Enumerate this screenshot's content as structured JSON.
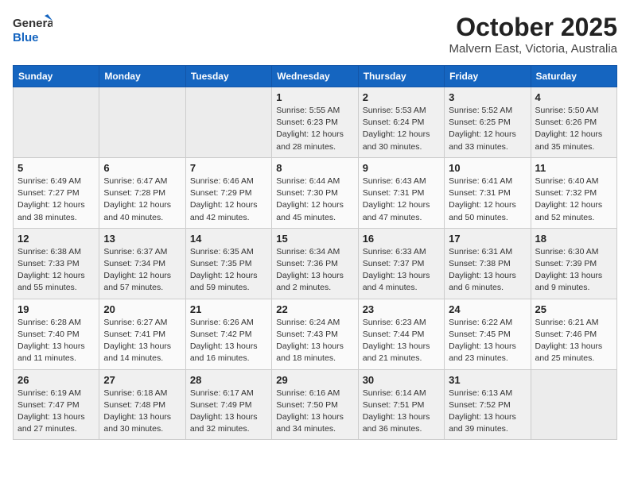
{
  "header": {
    "logo_general": "General",
    "logo_blue": "Blue",
    "month": "October 2025",
    "location": "Malvern East, Victoria, Australia"
  },
  "days_of_week": [
    "Sunday",
    "Monday",
    "Tuesday",
    "Wednesday",
    "Thursday",
    "Friday",
    "Saturday"
  ],
  "weeks": [
    [
      {
        "day": "",
        "info": ""
      },
      {
        "day": "",
        "info": ""
      },
      {
        "day": "",
        "info": ""
      },
      {
        "day": "1",
        "info": "Sunrise: 5:55 AM\nSunset: 6:23 PM\nDaylight: 12 hours and 28 minutes."
      },
      {
        "day": "2",
        "info": "Sunrise: 5:53 AM\nSunset: 6:24 PM\nDaylight: 12 hours and 30 minutes."
      },
      {
        "day": "3",
        "info": "Sunrise: 5:52 AM\nSunset: 6:25 PM\nDaylight: 12 hours and 33 minutes."
      },
      {
        "day": "4",
        "info": "Sunrise: 5:50 AM\nSunset: 6:26 PM\nDaylight: 12 hours and 35 minutes."
      }
    ],
    [
      {
        "day": "5",
        "info": "Sunrise: 6:49 AM\nSunset: 7:27 PM\nDaylight: 12 hours and 38 minutes."
      },
      {
        "day": "6",
        "info": "Sunrise: 6:47 AM\nSunset: 7:28 PM\nDaylight: 12 hours and 40 minutes."
      },
      {
        "day": "7",
        "info": "Sunrise: 6:46 AM\nSunset: 7:29 PM\nDaylight: 12 hours and 42 minutes."
      },
      {
        "day": "8",
        "info": "Sunrise: 6:44 AM\nSunset: 7:30 PM\nDaylight: 12 hours and 45 minutes."
      },
      {
        "day": "9",
        "info": "Sunrise: 6:43 AM\nSunset: 7:31 PM\nDaylight: 12 hours and 47 minutes."
      },
      {
        "day": "10",
        "info": "Sunrise: 6:41 AM\nSunset: 7:31 PM\nDaylight: 12 hours and 50 minutes."
      },
      {
        "day": "11",
        "info": "Sunrise: 6:40 AM\nSunset: 7:32 PM\nDaylight: 12 hours and 52 minutes."
      }
    ],
    [
      {
        "day": "12",
        "info": "Sunrise: 6:38 AM\nSunset: 7:33 PM\nDaylight: 12 hours and 55 minutes."
      },
      {
        "day": "13",
        "info": "Sunrise: 6:37 AM\nSunset: 7:34 PM\nDaylight: 12 hours and 57 minutes."
      },
      {
        "day": "14",
        "info": "Sunrise: 6:35 AM\nSunset: 7:35 PM\nDaylight: 12 hours and 59 minutes."
      },
      {
        "day": "15",
        "info": "Sunrise: 6:34 AM\nSunset: 7:36 PM\nDaylight: 13 hours and 2 minutes."
      },
      {
        "day": "16",
        "info": "Sunrise: 6:33 AM\nSunset: 7:37 PM\nDaylight: 13 hours and 4 minutes."
      },
      {
        "day": "17",
        "info": "Sunrise: 6:31 AM\nSunset: 7:38 PM\nDaylight: 13 hours and 6 minutes."
      },
      {
        "day": "18",
        "info": "Sunrise: 6:30 AM\nSunset: 7:39 PM\nDaylight: 13 hours and 9 minutes."
      }
    ],
    [
      {
        "day": "19",
        "info": "Sunrise: 6:28 AM\nSunset: 7:40 PM\nDaylight: 13 hours and 11 minutes."
      },
      {
        "day": "20",
        "info": "Sunrise: 6:27 AM\nSunset: 7:41 PM\nDaylight: 13 hours and 14 minutes."
      },
      {
        "day": "21",
        "info": "Sunrise: 6:26 AM\nSunset: 7:42 PM\nDaylight: 13 hours and 16 minutes."
      },
      {
        "day": "22",
        "info": "Sunrise: 6:24 AM\nSunset: 7:43 PM\nDaylight: 13 hours and 18 minutes."
      },
      {
        "day": "23",
        "info": "Sunrise: 6:23 AM\nSunset: 7:44 PM\nDaylight: 13 hours and 21 minutes."
      },
      {
        "day": "24",
        "info": "Sunrise: 6:22 AM\nSunset: 7:45 PM\nDaylight: 13 hours and 23 minutes."
      },
      {
        "day": "25",
        "info": "Sunrise: 6:21 AM\nSunset: 7:46 PM\nDaylight: 13 hours and 25 minutes."
      }
    ],
    [
      {
        "day": "26",
        "info": "Sunrise: 6:19 AM\nSunset: 7:47 PM\nDaylight: 13 hours and 27 minutes."
      },
      {
        "day": "27",
        "info": "Sunrise: 6:18 AM\nSunset: 7:48 PM\nDaylight: 13 hours and 30 minutes."
      },
      {
        "day": "28",
        "info": "Sunrise: 6:17 AM\nSunset: 7:49 PM\nDaylight: 13 hours and 32 minutes."
      },
      {
        "day": "29",
        "info": "Sunrise: 6:16 AM\nSunset: 7:50 PM\nDaylight: 13 hours and 34 minutes."
      },
      {
        "day": "30",
        "info": "Sunrise: 6:14 AM\nSunset: 7:51 PM\nDaylight: 13 hours and 36 minutes."
      },
      {
        "day": "31",
        "info": "Sunrise: 6:13 AM\nSunset: 7:52 PM\nDaylight: 13 hours and 39 minutes."
      },
      {
        "day": "",
        "info": ""
      }
    ]
  ]
}
